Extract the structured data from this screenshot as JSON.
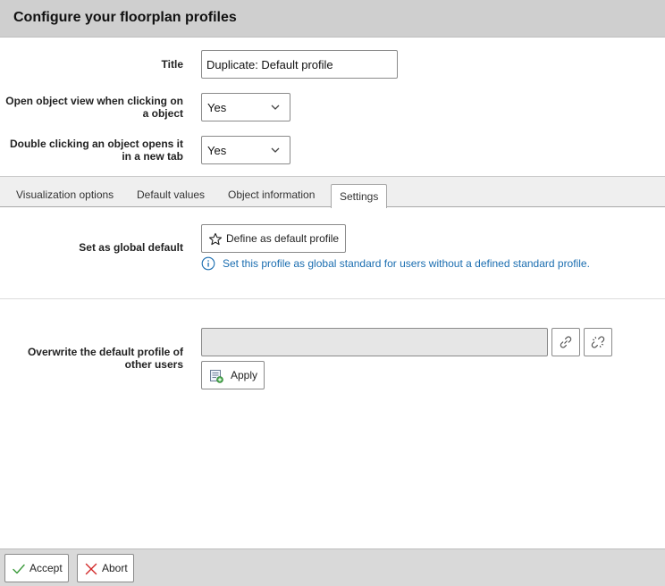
{
  "header": {
    "title": "Configure your floorplan profiles"
  },
  "form": {
    "title_label": "Title",
    "title_value": "Duplicate: Default profile",
    "open_view_label_line1": "Open object view when clicking on",
    "open_view_label_line2": "a object",
    "open_view_value": "Yes",
    "double_click_label_line1": "Double clicking an object opens it",
    "double_click_label_line2": "in a new tab",
    "double_click_value": "Yes"
  },
  "tabs": [
    {
      "label": "Visualization options",
      "active": false
    },
    {
      "label": "Default values",
      "active": false
    },
    {
      "label": "Object information",
      "active": false
    },
    {
      "label": "Settings",
      "active": true
    }
  ],
  "settings": {
    "global_default_label": "Set as global default",
    "define_default_button": "Define as default profile",
    "info_text": "Set this profile as global standard for users without a defined standard profile.",
    "overwrite_label_line1": "Overwrite the default profile of",
    "overwrite_label_line2": "other users",
    "overwrite_value": "",
    "apply_button": "Apply"
  },
  "footer": {
    "accept_button": "Accept",
    "abort_button": "Abort"
  },
  "colors": {
    "header_bg": "#cfcfcf",
    "info_text": "#1a6db0",
    "accept_icon": "#3a9a3a",
    "abort_icon": "#d22a2a"
  }
}
